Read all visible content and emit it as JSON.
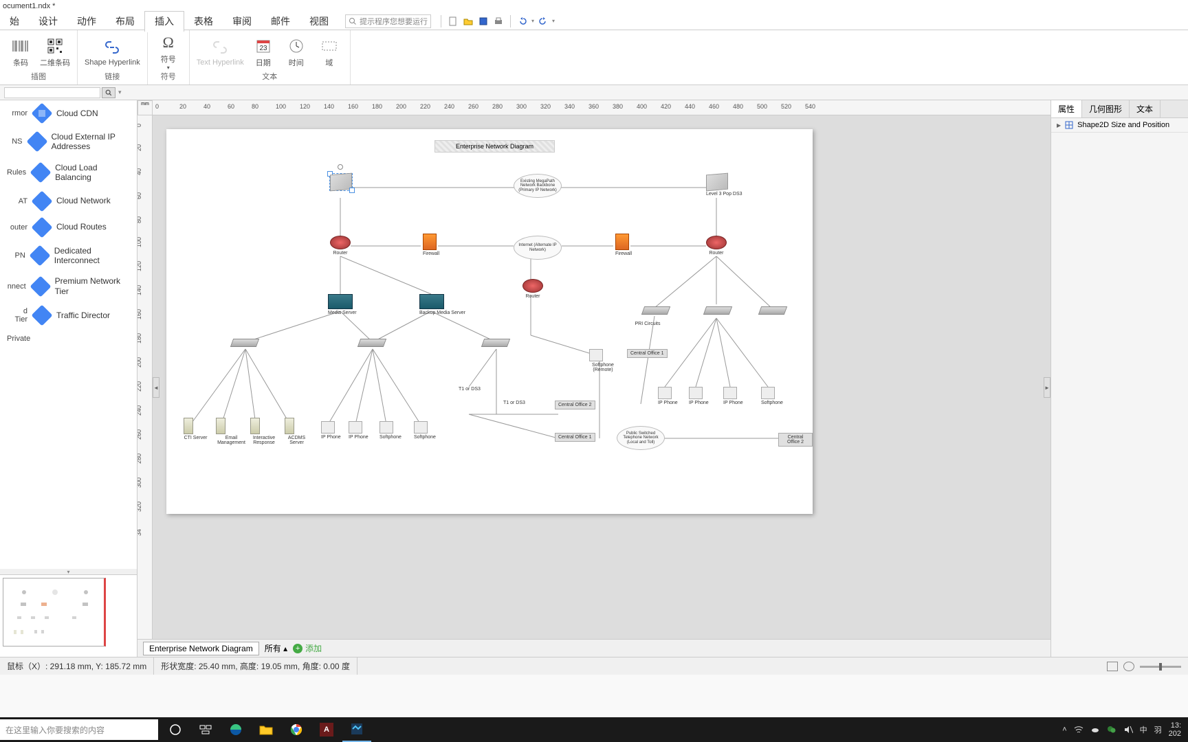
{
  "window": {
    "title": "ocument1.ndx *"
  },
  "menu": {
    "items": [
      "始",
      "设计",
      "动作",
      "布局",
      "插入",
      "表格",
      "审阅",
      "邮件",
      "视图"
    ],
    "active_index": 4,
    "search_placeholder": "提示程序您想要运行"
  },
  "ribbon": {
    "groups": [
      {
        "label": "插图",
        "items": [
          {
            "label": "条码"
          },
          {
            "label": "二维条码"
          }
        ]
      },
      {
        "label": "链接",
        "items": [
          {
            "label": "Shape Hyperlink"
          }
        ]
      },
      {
        "label": "符号",
        "items": [
          {
            "label": "符号"
          }
        ]
      },
      {
        "label": "文本",
        "items": [
          {
            "label": "Text Hyperlink",
            "disabled": true
          },
          {
            "label": "日期"
          },
          {
            "label": "时间"
          },
          {
            "label": "域"
          }
        ]
      }
    ]
  },
  "shapes_panel": {
    "rows": [
      {
        "left": "rmor",
        "label": "Cloud CDN"
      },
      {
        "left": "NS",
        "label": "Cloud External IP Addresses"
      },
      {
        "left": "Rules",
        "label": "Cloud Load Balancing"
      },
      {
        "left": "AT",
        "label": "Cloud Network"
      },
      {
        "left": "outer",
        "label": "Cloud Routes"
      },
      {
        "left": "PN",
        "label": "Dedicated Interconnect"
      },
      {
        "left": "nnect",
        "label": "Premium Network Tier"
      },
      {
        "left": "d\n Tier",
        "label": "Traffic Director"
      },
      {
        "left": "Private",
        "label": ""
      }
    ]
  },
  "ruler": {
    "unit": "mm",
    "h_ticks": [
      "0",
      "20",
      "40",
      "60",
      "80",
      "100",
      "120",
      "140",
      "160",
      "180",
      "200",
      "220",
      "240",
      "260",
      "280",
      "300",
      "320",
      "340",
      "360",
      "380",
      "400",
      "420",
      "440",
      "460",
      "480",
      "500",
      "520",
      "540"
    ],
    "v_ticks": [
      "0",
      "20",
      "40",
      "60",
      "80",
      "100",
      "120",
      "140",
      "160",
      "180",
      "200",
      "220",
      "240",
      "260",
      "280",
      "300",
      "320",
      "34"
    ]
  },
  "diagram": {
    "title": "Enterprise Network Diagram",
    "nodes": {
      "selected_box": "Level 3 Pop",
      "cloud1": "Existing MegaPath Network Backbone (Primary IP Network)",
      "box_right": "Level 3 Pop DS3",
      "router1": "Router",
      "firewall1": "Firewall",
      "cloud2": "Internet (Alternate IP Network)",
      "firewall2": "Firewall",
      "router2": "Router",
      "router3": "Router",
      "media_server": "Media Server",
      "backup_media": "Backup Media Server",
      "pri_circuits": "PRI Circuits",
      "softphone_remote": "Softphone (Remote)",
      "co1": "Central Office 1",
      "co2_a": "Central Office 2",
      "co1_a": "Central Office 1",
      "co2_b": "Central Office 2",
      "t1": "T1 or DS3",
      "t1_b": "T1 or DS3",
      "cloud3": "Public Switched Telephone Network (Local and Toll)",
      "servers": [
        "CTI Server",
        "Email Management",
        "Interactive Response",
        "ACDMS Server"
      ],
      "phones_left": [
        "IP Phone",
        "IP Phone",
        "Softphone",
        "Softphone"
      ],
      "phones_right": [
        "IP Phone",
        "IP Phone",
        "IP Phone",
        "Softphone"
      ]
    }
  },
  "sheet_tabs": {
    "active": "Enterprise Network Diagram",
    "all": "所有",
    "add": "添加"
  },
  "right_panel": {
    "tabs": [
      "属性",
      "几何图形",
      "文本"
    ],
    "active": 0,
    "property": "Shape2D Size and Position"
  },
  "status": {
    "mouse": "鼠标（X）: 291.18 mm, Y: 185.72 mm",
    "shape": "形状宽度: 25.40 mm, 高度: 19.05 mm, 角度: 0.00 度"
  },
  "taskbar": {
    "search": "在这里输入你要搜索的内容",
    "time": "13:",
    "date": "202",
    "ime": "中",
    "lang": "羽"
  }
}
